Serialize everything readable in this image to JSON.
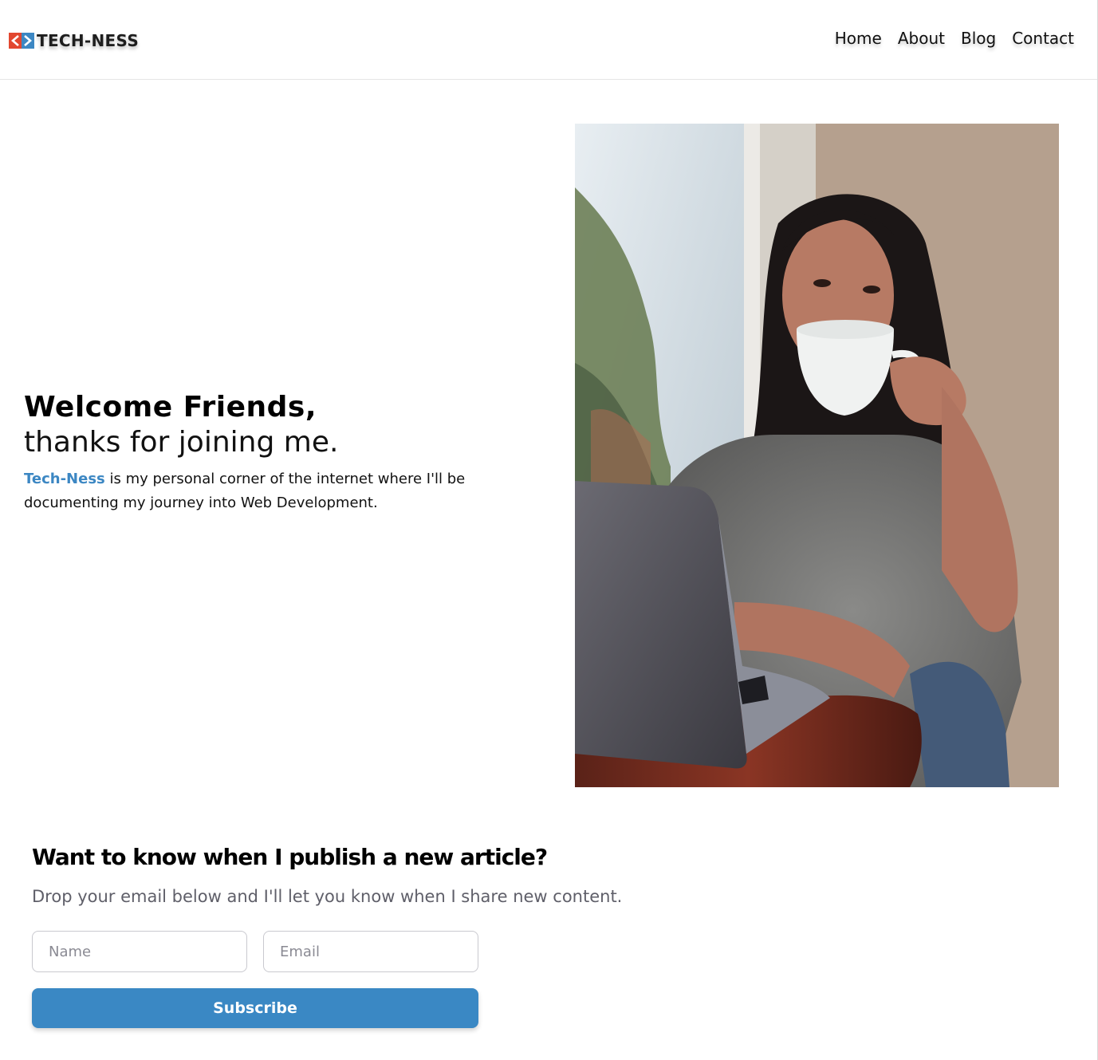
{
  "header": {
    "logo_text": "TECH-NESS",
    "logo_icon": "code-brackets-icon",
    "nav": [
      "Home",
      "About",
      "Blog",
      "Contact"
    ]
  },
  "hero": {
    "title": "Welcome Friends,",
    "subtitle": "thanks for joining me.",
    "brand": "Tech-Ness",
    "body": " is my personal corner of the internet where I'll be documenting my journey into Web Development."
  },
  "subscribe": {
    "title": "Want to know when I publish a new article?",
    "description": "Drop your email below and I'll let you know when I share new content.",
    "name_placeholder": "Name",
    "email_placeholder": "Email",
    "button_label": "Subscribe"
  },
  "colors": {
    "accent": "#3a88c4",
    "logo_red": "#e2472f",
    "logo_blue": "#3c87c3"
  }
}
